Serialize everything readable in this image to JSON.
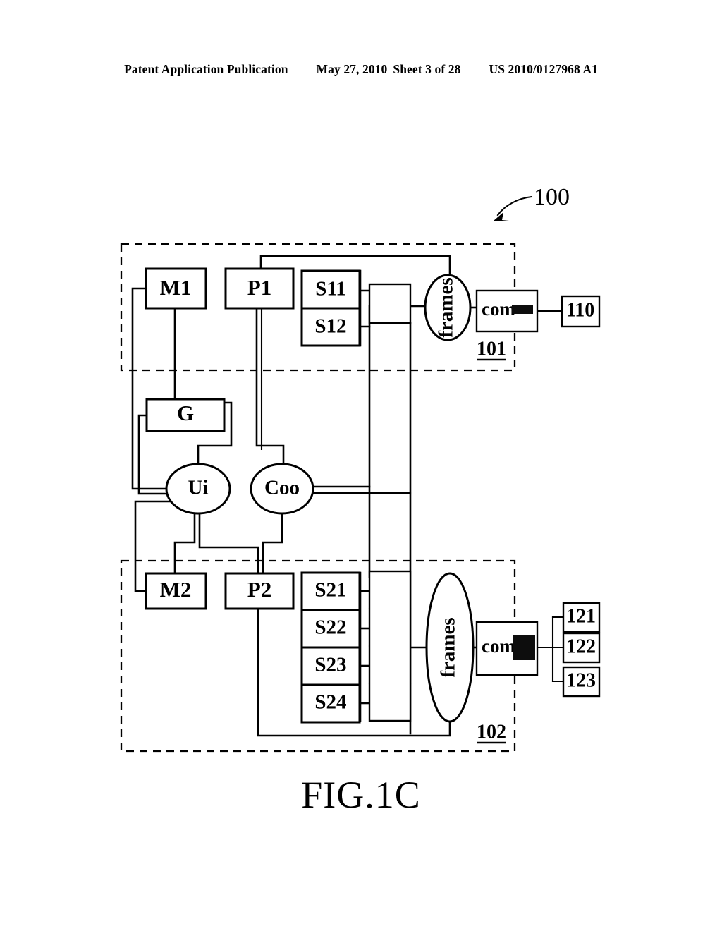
{
  "header": {
    "publication": "Patent Application Publication",
    "date": "May 27, 2010",
    "sheet": "Sheet 3 of 28",
    "patent_number": "US 2010/0127968 A1"
  },
  "figure": {
    "caption": "FIG.1C",
    "system_callout": "100"
  },
  "regions": [
    {
      "id": "region-101",
      "ref": "101"
    },
    {
      "id": "region-102",
      "ref": "102"
    }
  ],
  "blocks": {
    "m1": "M1",
    "p1": "P1",
    "s11": "S11",
    "s12": "S12",
    "g": "G",
    "ui": "Ui",
    "coo": "Coo",
    "m2": "M2",
    "p2": "P2",
    "s21": "S21",
    "s22": "S22",
    "s23": "S23",
    "s24": "S24",
    "frames_top": "frames",
    "frames_bottom": "frames",
    "com_top": "com",
    "com_bottom": "com"
  },
  "terminals": {
    "t110": "110",
    "t121": "121",
    "t122": "122",
    "t123": "123"
  },
  "icons": {
    "com_top_antenna": "antenna-bar-icon",
    "com_bottom_antenna": "antenna-block-icon",
    "callout_arrow": "curved-arrow-icon"
  }
}
